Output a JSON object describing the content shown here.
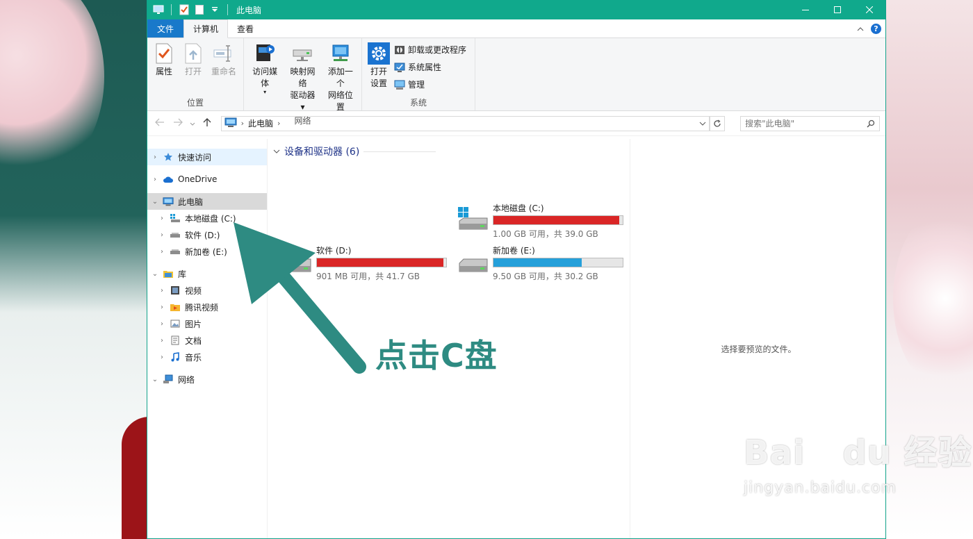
{
  "window": {
    "title": "此电脑",
    "controls": [
      "minimize",
      "maximize",
      "close"
    ]
  },
  "ribbon": {
    "tabs": [
      {
        "label": "文件"
      },
      {
        "label": "计算机"
      },
      {
        "label": "查看"
      }
    ],
    "groups": {
      "location": {
        "label": "位置",
        "buttons": [
          {
            "label": "属性",
            "icon": "properties-icon",
            "enabled": true
          },
          {
            "label": "打开",
            "icon": "open-icon",
            "enabled": false
          },
          {
            "label": "重命名",
            "icon": "rename-icon",
            "enabled": false
          }
        ]
      },
      "network": {
        "label": "网络",
        "buttons": [
          {
            "label": "访问媒体",
            "icon": "media-icon"
          },
          {
            "label": "映射网络\n驱动器",
            "label_line1": "映射网络",
            "label_line2": "驱动器",
            "icon": "map-drive-icon"
          },
          {
            "label_line1": "添加一个",
            "label_line2": "网络位置",
            "icon": "add-network-location-icon"
          }
        ]
      },
      "system": {
        "label": "系统",
        "open_settings_line1": "打开",
        "open_settings_line2": "设置",
        "small_buttons": [
          {
            "label": "卸载或更改程序",
            "icon": "uninstall-icon"
          },
          {
            "label": "系统属性",
            "icon": "system-properties-icon"
          },
          {
            "label": "管理",
            "icon": "manage-icon"
          }
        ]
      }
    }
  },
  "address": {
    "path": "此电脑",
    "search_placeholder": "搜索\"此电脑\""
  },
  "navpane": {
    "quick_access": "快速访问",
    "onedrive": "OneDrive",
    "this_pc": "此电脑",
    "drives": [
      "本地磁盘 (C:)",
      "软件 (D:)",
      "新加卷 (E:)"
    ],
    "library": "库",
    "library_items": [
      "视频",
      "腾讯视频",
      "图片",
      "文档",
      "音乐"
    ],
    "network": "网络"
  },
  "main": {
    "section_title": "设备和驱动器 (6)",
    "drives": [
      {
        "name": "本地磁盘 (C:)",
        "free_text": "1.00 GB 可用，共 39.0 GB",
        "used_fraction": 0.974,
        "bar_color": "#da2626"
      },
      {
        "name": "软件 (D:)",
        "free_text": "901 MB 可用，共 41.7 GB",
        "used_fraction": 0.979,
        "bar_color": "#da2626"
      },
      {
        "name": "新加卷 (E:)",
        "free_text": "9.50 GB 可用，共 30.2 GB",
        "used_fraction": 0.685,
        "bar_color": "#26a0da"
      }
    ],
    "preview_text": "选择要预览的文件。"
  },
  "annotation": {
    "text": "点击C盘",
    "color": "#2e8b82"
  },
  "watermark": {
    "logo": "Bai du 经验",
    "url": "jingyan.baidu.com"
  }
}
